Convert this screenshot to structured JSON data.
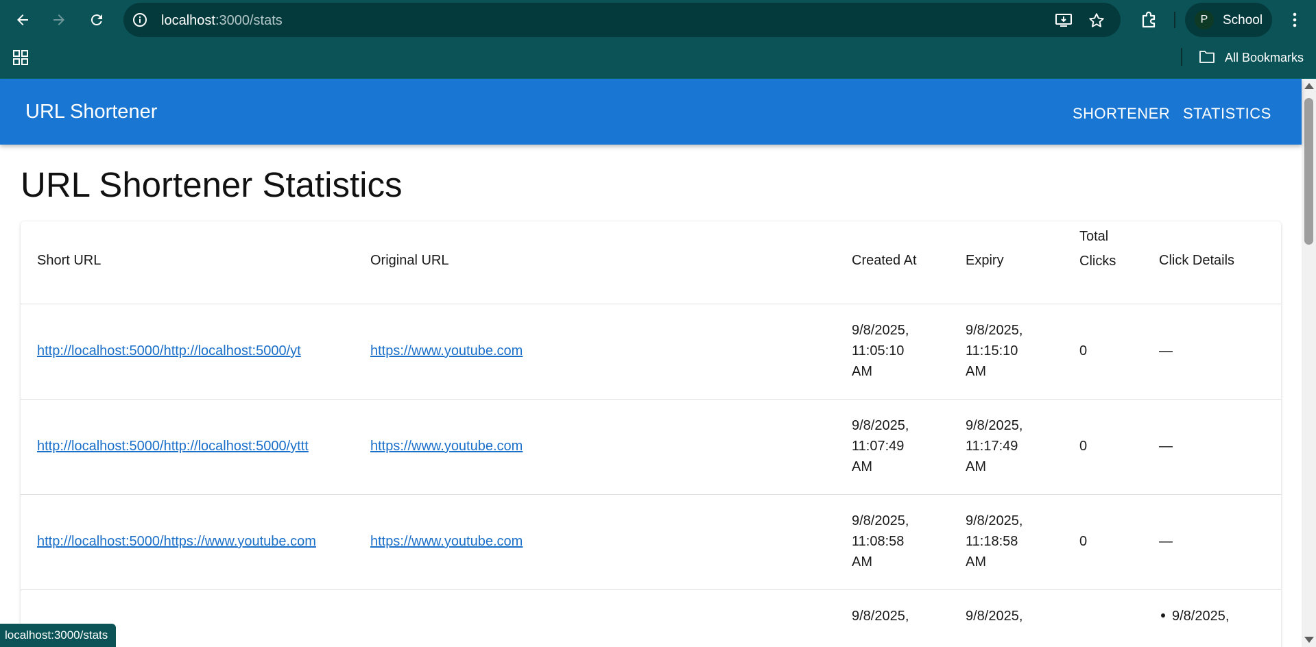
{
  "browser": {
    "url_host": "localhost",
    "url_path": ":3000/stats",
    "profile_initial": "P",
    "profile_name": "School",
    "bookmarks_label": "All Bookmarks",
    "status_url": "localhost:3000/stats"
  },
  "appbar": {
    "brand": "URL Shortener",
    "nav": [
      "SHORTENER",
      "STATISTICS"
    ]
  },
  "page": {
    "title": "URL Shortener Statistics"
  },
  "table": {
    "headers": {
      "short_url": "Short URL",
      "original_url": "Original URL",
      "created_at": "Created At",
      "expiry": "Expiry",
      "total_clicks_line1": "Total",
      "total_clicks_line2": "Clicks",
      "click_details": "Click Details"
    },
    "rows": [
      {
        "short_url": "http://localhost:5000/http://localhost:5000/yt",
        "original_url": "https://www.youtube.com",
        "created": [
          "9/8/2025,",
          "11:05:10",
          "AM"
        ],
        "expiry": [
          "9/8/2025,",
          "11:15:10",
          "AM"
        ],
        "total_clicks": "0",
        "click_details": "—"
      },
      {
        "short_url": "http://localhost:5000/http://localhost:5000/yttt",
        "original_url": "https://www.youtube.com",
        "created": [
          "9/8/2025,",
          "11:07:49",
          "AM"
        ],
        "expiry": [
          "9/8/2025,",
          "11:17:49",
          "AM"
        ],
        "total_clicks": "0",
        "click_details": "—"
      },
      {
        "short_url": "http://localhost:5000/https://www.youtube.com",
        "original_url": "https://www.youtube.com",
        "created": [
          "9/8/2025,",
          "11:08:58",
          "AM"
        ],
        "expiry": [
          "9/8/2025,",
          "11:18:58",
          "AM"
        ],
        "total_clicks": "0",
        "click_details": "—"
      },
      {
        "created": [
          "9/8/2025,"
        ],
        "expiry": [
          "9/8/2025,"
        ],
        "click_details_items": [
          "9/8/2025,"
        ]
      }
    ]
  },
  "colors": {
    "chrome": "#0b5357",
    "appbar": "#1976d2",
    "link": "#1a6fc9"
  }
}
